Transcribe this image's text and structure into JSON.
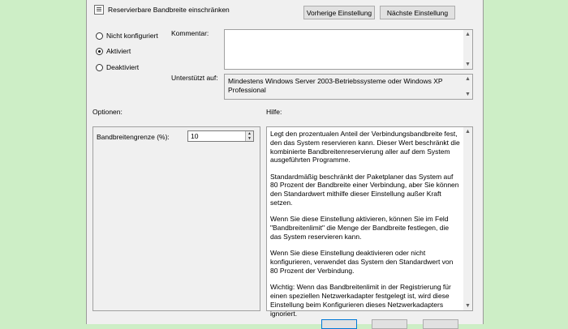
{
  "header": {
    "title": "Reservierbare Bandbreite einschränken",
    "prev_button": "Vorherige Einstellung",
    "next_button": "Nächste Einstellung"
  },
  "state": {
    "options": [
      {
        "label": "Nicht konfiguriert",
        "checked": false
      },
      {
        "label": "Aktiviert",
        "checked": true
      },
      {
        "label": "Deaktiviert",
        "checked": false
      }
    ]
  },
  "comment": {
    "label": "Kommentar:",
    "value": ""
  },
  "supported": {
    "label": "Unterstützt auf:",
    "value": "Mindestens Windows Server 2003-Betriebssysteme oder Windows XP Professional"
  },
  "options_section": {
    "label": "Optionen:",
    "field_label": "Bandbreitengrenze (%):",
    "field_value": "10"
  },
  "help_section": {
    "label": "Hilfe:",
    "paragraphs": [
      "Legt den prozentualen Anteil der Verbindungsbandbreite fest, den das System reservieren kann. Dieser Wert beschränkt die kombinierte Bandbreitenreservierung aller auf dem System ausgeführten Programme.",
      "Standardmäßig beschränkt der Paketplaner das System auf 80 Prozent der Bandbreite einer Verbindung, aber Sie können den Standardwert mithilfe dieser Einstellung außer Kraft setzen.",
      "Wenn Sie diese Einstellung aktivieren, können Sie im Feld \"Bandbreitenlimit\" die Menge der Bandbreite festlegen, die das System reservieren kann.",
      "Wenn Sie diese Einstellung deaktivieren oder nicht konfigurieren, verwendet das System den Standardwert von 80 Prozent der Verbindung.",
      "Wichtig: Wenn das Bandbreitenlimit in der Registrierung für einen speziellen Netzwerkadapter festgelegt ist, wird diese Einstellung beim Konfigurieren dieses Netzwerkadapters ignoriert."
    ]
  }
}
